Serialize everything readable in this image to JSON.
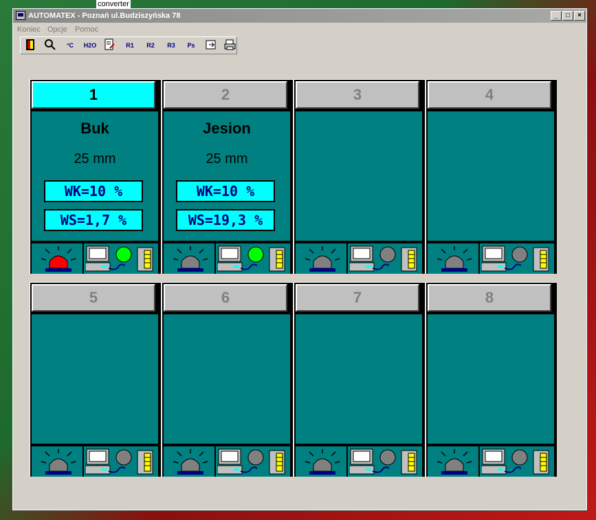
{
  "desktop": {
    "label": "converter"
  },
  "window": {
    "title": "AUTOMATEX -  Poznań ul.Budziszyńska 78",
    "buttons": {
      "minimize": "_",
      "maximize": "□",
      "close": "×"
    }
  },
  "menu": {
    "items": [
      "Koniec",
      "Opcje",
      "Pomoc"
    ]
  },
  "toolbar": {
    "items": [
      {
        "name": "exit-icon",
        "label": ""
      },
      {
        "name": "search-icon",
        "label": ""
      },
      {
        "name": "temp-chart-icon",
        "label": "°C"
      },
      {
        "name": "h2o-chart-icon",
        "label": "H2O"
      },
      {
        "name": "edit-doc-icon",
        "label": ""
      },
      {
        "name": "r1-icon",
        "label": "R1"
      },
      {
        "name": "r2-icon",
        "label": "R2"
      },
      {
        "name": "r3-icon",
        "label": "R3"
      },
      {
        "name": "ps-icon",
        "label": "Ps"
      },
      {
        "name": "export-icon",
        "label": ""
      },
      {
        "name": "print-icon",
        "label": ""
      }
    ]
  },
  "colors": {
    "panel_body": "#008080",
    "active_header": "#00ffff",
    "alarm_on": "#ff0000",
    "alarm_off": "#808080",
    "status_ok": "#00ff00",
    "status_off": "#808080"
  },
  "chambers": [
    {
      "number": "1",
      "active": true,
      "species": "Buk",
      "thickness": "25 mm",
      "wk": "WK=10 %",
      "ws": "WS=1,7 %",
      "alarm": "on",
      "status": "ok"
    },
    {
      "number": "2",
      "active": false,
      "species": "Jesion",
      "thickness": "25 mm",
      "wk": "WK=10 %",
      "ws": "WS=19,3 %",
      "alarm": "off",
      "status": "ok"
    },
    {
      "number": "3",
      "active": false,
      "alarm": "off",
      "status": "off"
    },
    {
      "number": "4",
      "active": false,
      "alarm": "off",
      "status": "off"
    },
    {
      "number": "5",
      "active": false,
      "alarm": "off",
      "status": "off"
    },
    {
      "number": "6",
      "active": false,
      "alarm": "off",
      "status": "off"
    },
    {
      "number": "7",
      "active": false,
      "alarm": "off",
      "status": "off"
    },
    {
      "number": "8",
      "active": false,
      "alarm": "off",
      "status": "off"
    }
  ]
}
